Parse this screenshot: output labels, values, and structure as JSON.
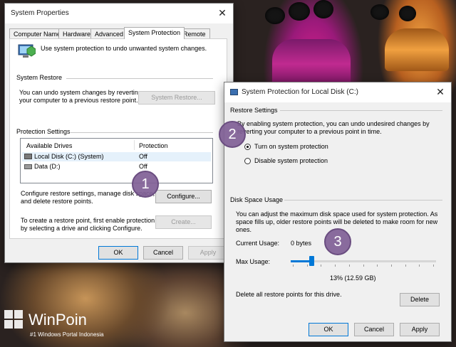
{
  "background": {
    "brand_name": "WinPoin",
    "brand_tagline": "#1 Windows Portal Indonesia"
  },
  "sysprops": {
    "title": "System Properties",
    "tabs": [
      "Computer Name",
      "Hardware",
      "Advanced",
      "System Protection",
      "Remote"
    ],
    "active_tab": "System Protection",
    "intro": "Use system protection to undo unwanted system changes.",
    "system_restore": {
      "heading": "System Restore",
      "desc_line1": "You can undo system changes by reverting",
      "desc_line2": "your computer to a previous restore point.",
      "button": "System Restore..."
    },
    "protection": {
      "heading": "Protection Settings",
      "col_drives": "Available Drives",
      "col_protection": "Protection",
      "drives": [
        {
          "name": "Local Disk (C:) (System)",
          "protection": "Off"
        },
        {
          "name": "Data (D:)",
          "protection": "Off"
        }
      ],
      "configure_desc_line1": "Configure restore settings, manage disk space,",
      "configure_desc_line2": "and delete restore points.",
      "configure_button": "Configure...",
      "create_desc_line1": "To create a restore point, first enable protection",
      "create_desc_line2": "by selecting a drive and clicking Configure.",
      "create_button": "Create..."
    },
    "buttons": {
      "ok": "OK",
      "cancel": "Cancel",
      "apply": "Apply"
    }
  },
  "protection_dialog": {
    "title": "System Protection for Local Disk (C:)",
    "restore_settings": {
      "heading": "Restore Settings",
      "desc_line1": "By enabling system protection, you can undo undesired changes by",
      "desc_line2": "reverting your computer to a previous point in time.",
      "option_on": "Turn on system protection",
      "option_off": "Disable system protection",
      "selected": "Turn on system protection"
    },
    "disk_space": {
      "heading": "Disk Space Usage",
      "desc_line1": "You can adjust the maximum disk space used for system protection. As",
      "desc_line2": "space fills up, older restore points will be deleted to make room for new",
      "desc_line3": "ones.",
      "current_usage_label": "Current Usage:",
      "current_usage_value": "0 bytes",
      "max_usage_label": "Max Usage:",
      "max_usage_fraction": 0.13,
      "max_usage_value": "13% (12.59 GB)",
      "delete_desc": "Delete all restore points for this drive.",
      "delete_button": "Delete"
    },
    "buttons": {
      "ok": "OK",
      "cancel": "Cancel",
      "apply": "Apply"
    }
  },
  "callouts": [
    "1",
    "2",
    "3"
  ],
  "colors": {
    "accent": "#0078d7",
    "callout": "#805f96",
    "selected_row": "#e5f1fb"
  }
}
